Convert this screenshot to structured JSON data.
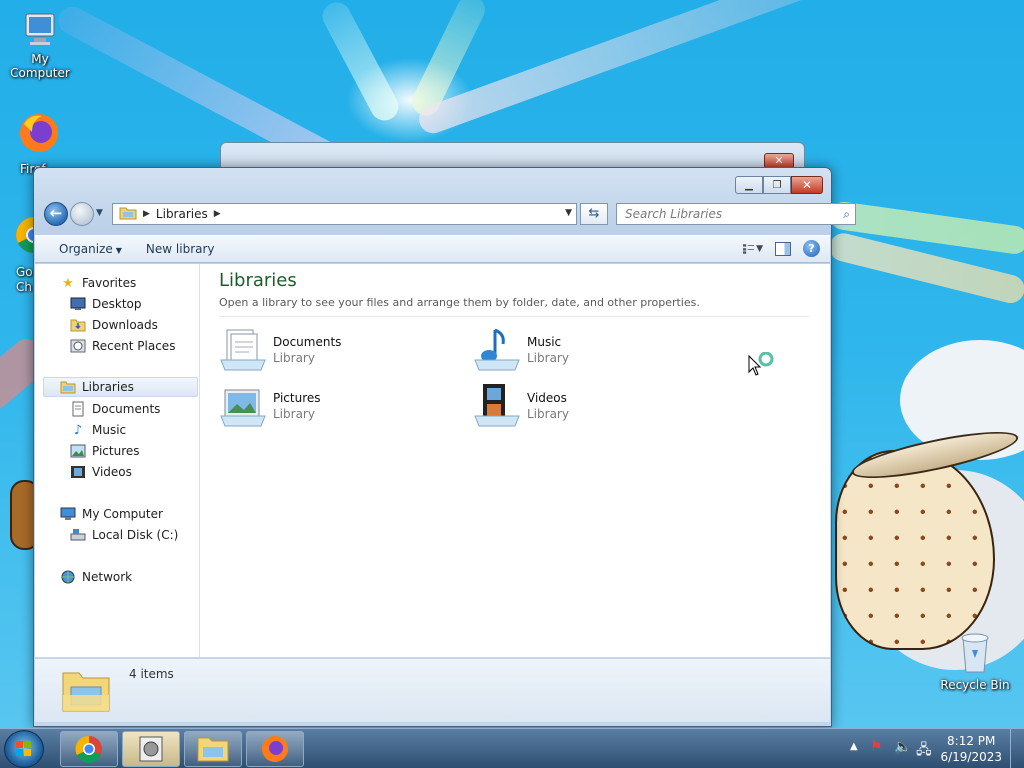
{
  "desktop": {
    "icons": [
      {
        "name": "computer-icon",
        "label": "My Computer"
      },
      {
        "name": "firefox-icon",
        "label": "Firef"
      },
      {
        "name": "chrome-icon",
        "label": "Go Ch"
      },
      {
        "name": "recycle-bin-icon",
        "label": "Recycle Bin"
      }
    ]
  },
  "window": {
    "address": {
      "crumb": "Libraries"
    },
    "search": {
      "placeholder": "Search Libraries"
    },
    "toolbar": {
      "organize": "Organize",
      "new_library": "New library"
    },
    "nav": {
      "favorites": "Favorites",
      "desktop": "Desktop",
      "downloads": "Downloads",
      "recent_places": "Recent Places",
      "libraries": "Libraries",
      "documents": "Documents",
      "music": "Music",
      "pictures": "Pictures",
      "videos": "Videos",
      "my_computer": "My Computer",
      "local_disk": "Local Disk (C:)",
      "network": "Network"
    },
    "main": {
      "title": "Libraries",
      "subtitle": "Open a library to see your files and arrange them by folder, date, and other properties.",
      "libraries": [
        {
          "name": "Documents",
          "type": "Library",
          "icon": "documents-library-icon"
        },
        {
          "name": "Music",
          "type": "Library",
          "icon": "music-library-icon"
        },
        {
          "name": "Pictures",
          "type": "Library",
          "icon": "pictures-library-icon"
        },
        {
          "name": "Videos",
          "type": "Library",
          "icon": "videos-library-icon"
        }
      ]
    },
    "details": {
      "count": "4 items"
    }
  },
  "taskbar": {
    "clock": {
      "time": "8:12 PM",
      "date": "6/19/2023"
    },
    "apps": [
      "chrome-icon",
      "media-player-icon",
      "explorer-icon",
      "firefox-icon"
    ]
  },
  "colors": {
    "title_green": "#1e5c2e",
    "window_frame": "#c4d6ea",
    "taskbar": "#2e4f72"
  }
}
